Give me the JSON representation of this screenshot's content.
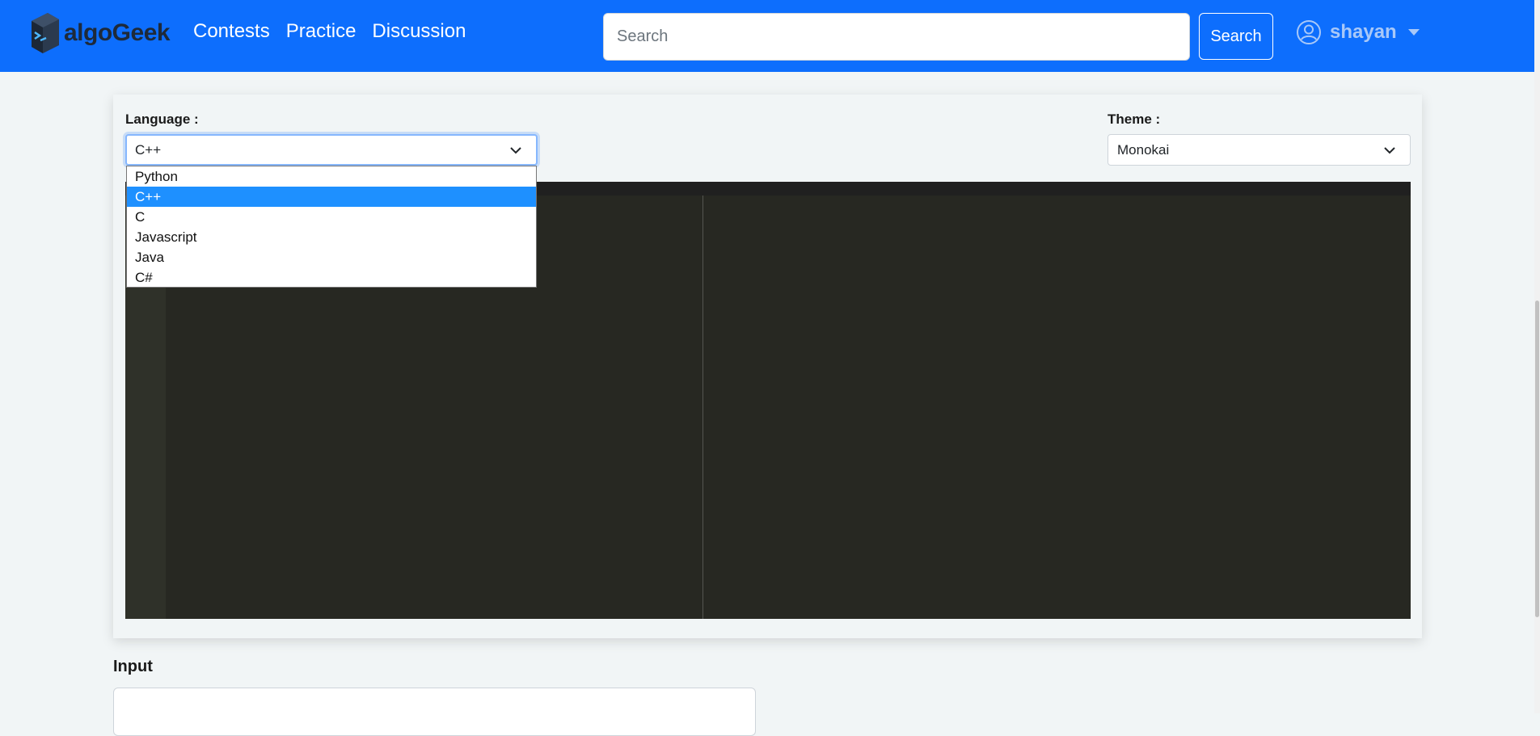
{
  "navbar": {
    "brand": "algoGeek",
    "links": [
      "Contests",
      "Practice",
      "Discussion"
    ],
    "search_placeholder": "Search",
    "search_button": "Search",
    "user_name": "shayan"
  },
  "editor": {
    "language_label": "Language :",
    "language_selected": "C++",
    "language_options": [
      "Python",
      "C++",
      "C",
      "Javascript",
      "Java",
      "C#"
    ],
    "theme_label": "Theme :",
    "theme_selected": "Monokai"
  },
  "input_section": {
    "label": "Input"
  },
  "colors": {
    "navbar": "#0d6efd",
    "editor_bg": "#272822",
    "gutter": "#2f3129",
    "selected_option": "#1e90ff"
  }
}
